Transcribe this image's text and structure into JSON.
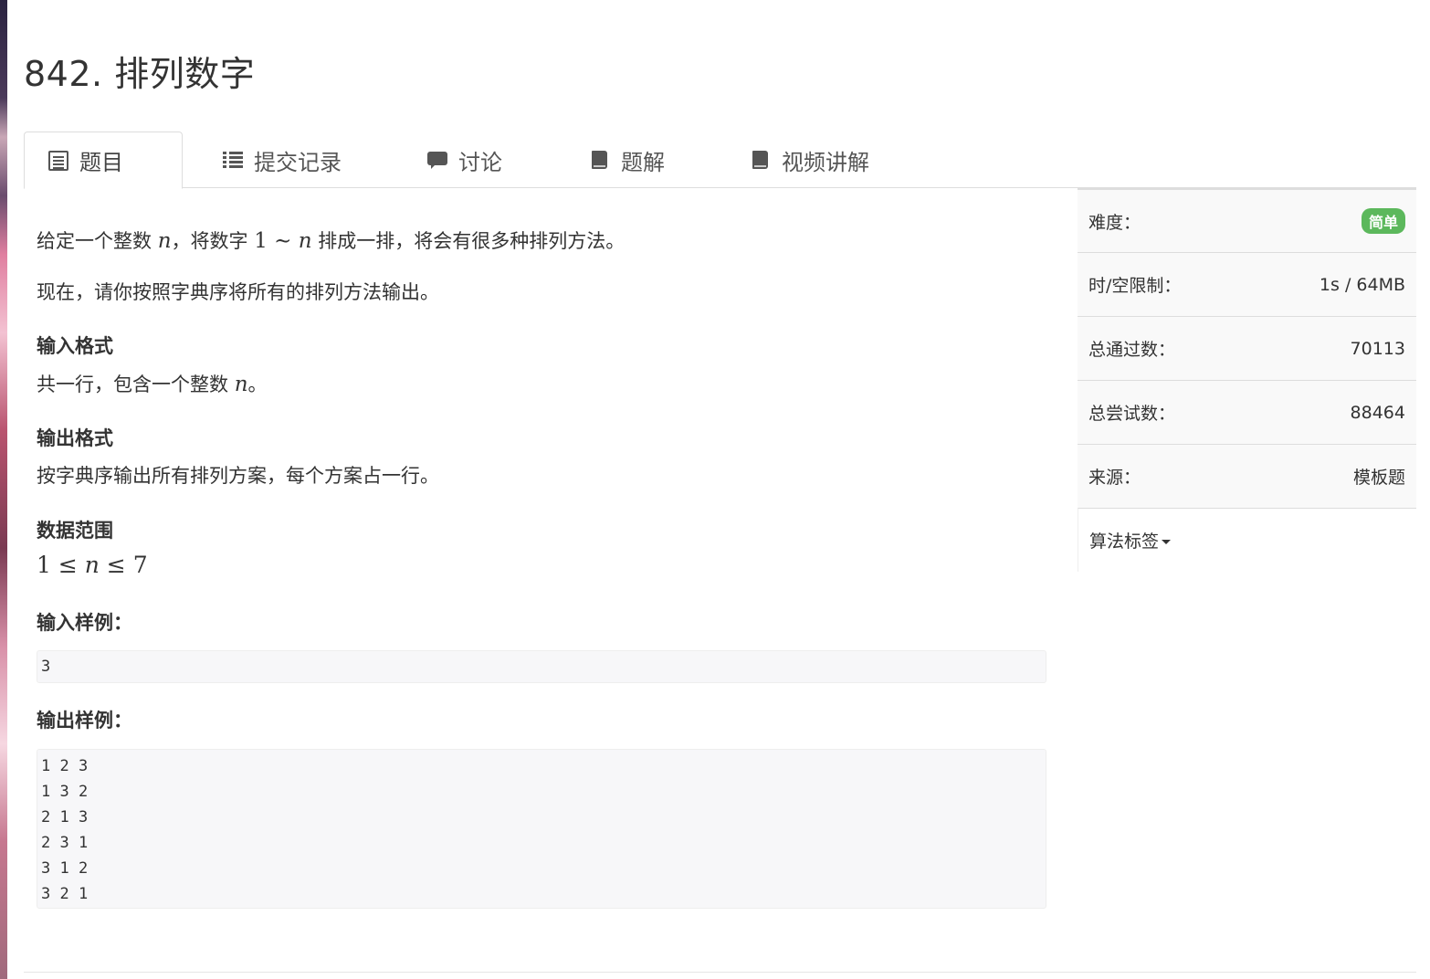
{
  "page": {
    "title": "842. 排列数字"
  },
  "tabs": [
    {
      "label": "题目",
      "icon": "doc-icon"
    },
    {
      "label": "提交记录",
      "icon": "list-icon"
    },
    {
      "label": "讨论",
      "icon": "chat-icon"
    },
    {
      "label": "题解",
      "icon": "book-icon"
    },
    {
      "label": "视频讲解",
      "icon": "book-icon"
    }
  ],
  "problem": {
    "desc1_a": "给定一个整数 ",
    "desc1_n": "n",
    "desc1_b": "，将数字 ",
    "desc1_one": "1",
    "desc1_tilde": " ∼ ",
    "desc1_n2": "n",
    "desc1_c": " 排成一排，将会有很多种排列方法。",
    "desc2": "现在，请你按照字典序将所有的排列方法输出。",
    "input_heading": "输入格式",
    "input_a": "共一行，包含一个整数 ",
    "input_n": "n",
    "input_b": "。",
    "output_heading": "输出格式",
    "output_text": "按字典序输出所有排列方案，每个方案占一行。",
    "range_heading": "数据范围",
    "range_1": "1",
    "range_le1": " ≤ ",
    "range_n": "n",
    "range_le2": " ≤ ",
    "range_7": "7",
    "sample_in_heading": "输入样例：",
    "sample_in": [
      "3"
    ],
    "sample_out_heading": "输出样例：",
    "sample_out": [
      "1 2 3",
      "1 3 2",
      "2 1 3",
      "2 3 1",
      "3 1 2",
      "3 2 1"
    ]
  },
  "sidebar": {
    "difficulty_label": "难度：",
    "difficulty_value": "简单",
    "difficulty_color": "#5cb85c",
    "limit_label": "时/空限制：",
    "limit_value": "1s / 64MB",
    "passed_label": "总通过数：",
    "passed_value": "70113",
    "tried_label": "总尝试数：",
    "tried_value": "88464",
    "source_label": "来源：",
    "source_value": "模板题",
    "tags_label": "算法标签"
  }
}
